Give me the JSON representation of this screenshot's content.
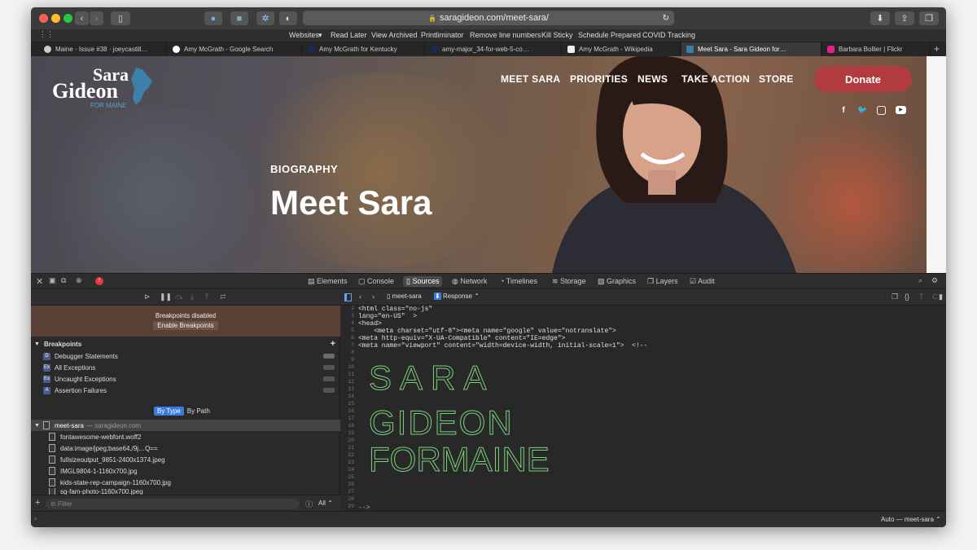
{
  "browser": {
    "url": "saragideon.com/meet-sara/",
    "bookmarks": [
      "Websites",
      "Read Later",
      "View Archived",
      "Printliminator",
      "Remove line numbers",
      "Kill Sticky",
      "Schedule Prepared",
      "COVID Tracking"
    ],
    "tabs": [
      {
        "title": "Maine · Issue #38 · joeycastill…",
        "active": false
      },
      {
        "title": "Amy McGrath - Google Search",
        "active": false
      },
      {
        "title": "Amy McGrath for Kentucky",
        "active": false
      },
      {
        "title": "amy-major_34-for-web-5-co…",
        "active": false
      },
      {
        "title": "Amy McGrath - Wikipedia",
        "active": false
      },
      {
        "title": "Meet Sara - Sara Gideon for…",
        "active": true
      },
      {
        "title": "Barbara Bollier | Flickr",
        "active": false
      }
    ]
  },
  "site": {
    "logo": {
      "line1": "Sara",
      "line2": "Gideon",
      "line3": "FOR MAINE"
    },
    "nav": [
      "MEET SARA",
      "PRIORITIES",
      "NEWS",
      "TAKE ACTION",
      "STORE"
    ],
    "donate": "Donate",
    "social_icons": [
      "facebook-icon",
      "twitter-icon",
      "instagram-icon",
      "youtube-icon"
    ],
    "eyebrow": "BIOGRAPHY",
    "headline": "Meet Sara",
    "colors": {
      "donate": "#b23b3f",
      "logo_blue": "#3c7fa8"
    }
  },
  "devtools": {
    "tabs": [
      "Elements",
      "Console",
      "Sources",
      "Network",
      "Timelines",
      "Storage",
      "Graphics",
      "Layers",
      "Audit"
    ],
    "active_tab": "Sources",
    "breakpoints_notice": "Breakpoints disabled",
    "enable_button": "Enable Breakpoints",
    "breakpoints_header": "Breakpoints",
    "breakpoints": [
      {
        "badge": "D",
        "label": "Debugger Statements"
      },
      {
        "badge": "Ex",
        "label": "All Exceptions"
      },
      {
        "badge": "Ex",
        "label": "Uncaught Exceptions"
      },
      {
        "badge": "A",
        "label": "Assertion Failures"
      }
    ],
    "segmented": [
      "By Type",
      "By Path"
    ],
    "resource_root": "meet-sara",
    "resource_host": "— saragideon.com",
    "files": [
      "fontawesome-webfont.woff2",
      "data:image/jpeg;base64,/9j…Q==",
      "fullsizeoutput_9851-2400x1374.jpeg",
      "IMGL9804-1-1160x700.jpg",
      "kids-state-rep-campaign-1160x700.jpg",
      "sg-fam-photo-1160x700.jpeg"
    ],
    "filter_placeholder": "Filter",
    "filter_scope": "All",
    "editor_file": "meet-sara",
    "editor_mode": "Response",
    "line_numbers": [
      "2",
      "3",
      "4",
      "5",
      "6",
      "7",
      "8",
      "9",
      "10",
      "11",
      "12",
      "13",
      "14",
      "15",
      "16",
      "17",
      "18",
      "19",
      "20",
      "21",
      "22",
      "23",
      "24",
      "25",
      "26",
      "27",
      "28",
      "29",
      "30"
    ],
    "code": {
      "l2": "<html class=\"no-js\"",
      "l3": "lang=\"en-US\"  >",
      "l4": "<head>",
      "l5": "    <meta charset=\"utf-8\"><meta name=\"google\" value=\"notranslate\">",
      "l6": "<meta http-equiv=\"X-UA-Compatible\" content=\"IE=edge\">",
      "l7": "<meta name=\"viewport\" content=\"width=device-width, initial-scale=1\">  <!--",
      "l29": "-->"
    },
    "ascii_words": [
      "SARA",
      "GIDEON",
      "FORMAINE"
    ],
    "context": "Auto — meet-sara"
  }
}
